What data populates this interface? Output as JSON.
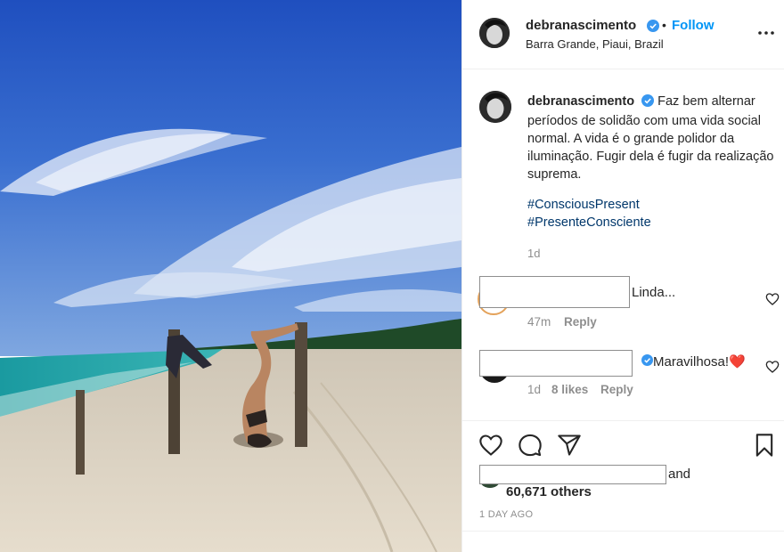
{
  "post": {
    "username": "debranascimento",
    "separator": "•",
    "follow_label": "Follow",
    "location": "Barra Grande, Piaui, Brazil",
    "caption": "Faz bem alternar períodos de solidão com uma vida social normal. A vida é o grande polidor da iluminação. Fugir dela é fugir da realização suprema.",
    "hashtags": [
      "#ConsciousPresent",
      "#PresenteConsciente"
    ],
    "caption_time": "1d",
    "likes_count": "60,671 others",
    "likes_and": "and",
    "date": "1 DAY AGO"
  },
  "comments": [
    {
      "text": "Linda...",
      "time": "47m",
      "reply_label": "Reply"
    },
    {
      "text": "Maravilhosa!",
      "emoji": "❤️",
      "time": "1d",
      "likes": "8 likes",
      "reply_label": "Reply"
    }
  ],
  "icons": {
    "verified": "verified-badge-icon",
    "more": "more-options-icon",
    "like": "heart-icon",
    "comment": "comment-icon",
    "share": "paper-plane-icon",
    "save": "bookmark-icon"
  },
  "colors": {
    "link_blue": "#0095f6",
    "hashtag": "#00376b",
    "muted": "#8e8e8e",
    "sky": "#2f63c9",
    "sea": "#1ea0a4",
    "sand": "#d9d0c1"
  }
}
